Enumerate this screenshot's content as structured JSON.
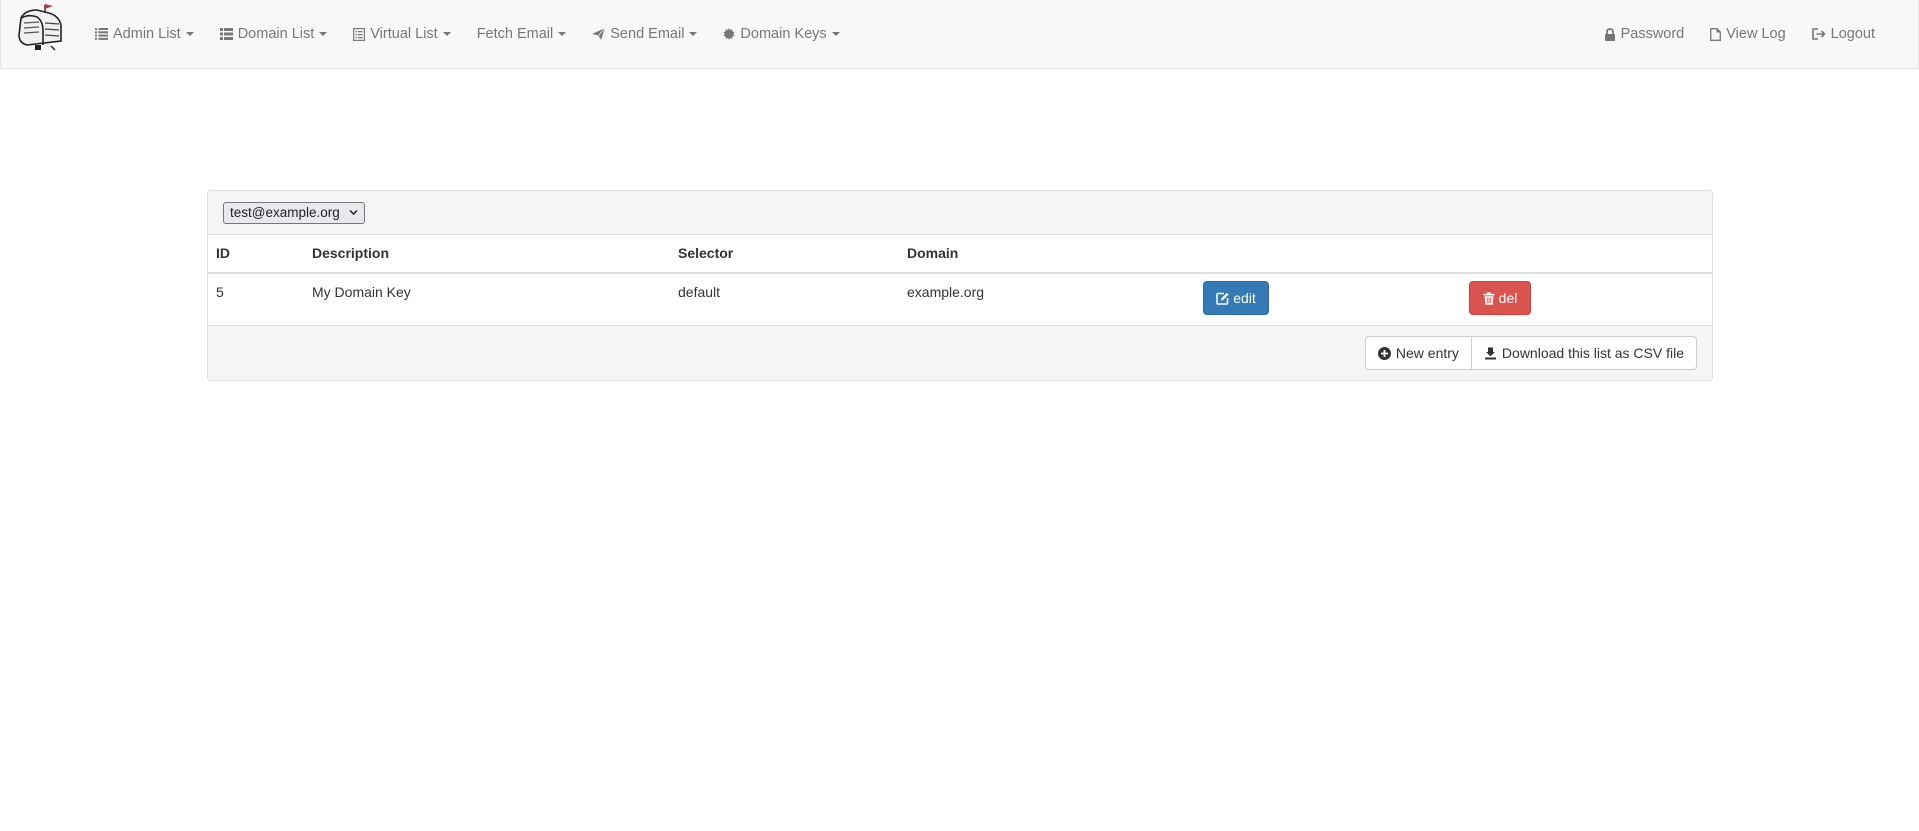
{
  "nav": {
    "left": [
      {
        "label": "Admin List",
        "icon": "list-icon"
      },
      {
        "label": "Domain List",
        "icon": "th-list-icon"
      },
      {
        "label": "Virtual List",
        "icon": "list-alt-icon"
      },
      {
        "label": "Fetch Email",
        "icon": ""
      },
      {
        "label": "Send Email",
        "icon": "send-icon"
      },
      {
        "label": "Domain Keys",
        "icon": "certificate-icon"
      }
    ],
    "right": [
      {
        "label": "Password",
        "icon": "lock-icon"
      },
      {
        "label": "View Log",
        "icon": "file-icon"
      },
      {
        "label": "Logout",
        "icon": "logout-icon"
      }
    ]
  },
  "panel": {
    "user_select": "test@example.org",
    "columns": [
      "ID",
      "Description",
      "Selector",
      "Domain"
    ],
    "rows": [
      {
        "id": "5",
        "description": "My Domain Key",
        "selector": "default",
        "domain": "example.org",
        "edit_label": "edit",
        "del_label": "del"
      }
    ],
    "new_entry_label": "New entry",
    "download_label": "Download this list as CSV file"
  },
  "colors": {
    "primary": "#337ab7",
    "danger": "#d9534f",
    "navbar_bg": "#f8f8f8",
    "panel_bg": "#f5f5f5"
  }
}
